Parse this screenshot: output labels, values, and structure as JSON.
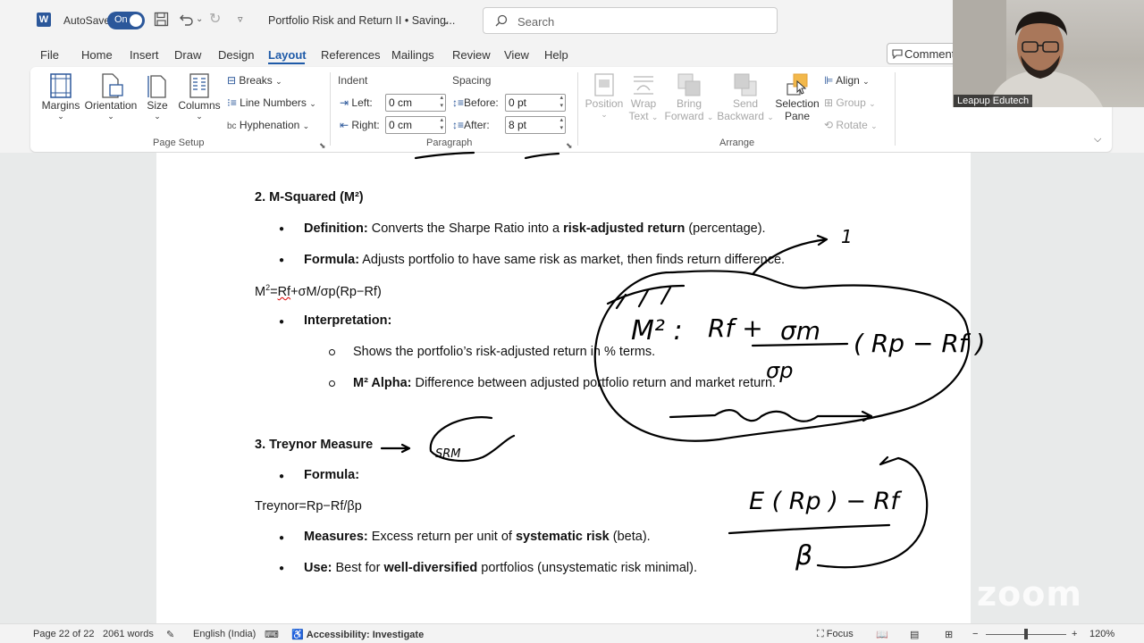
{
  "titlebar": {
    "app_icon": "word-icon",
    "app_icon_letter": "W",
    "autosave_label": "AutoSave",
    "autosave_state": "On",
    "document_title": "Portfolio Risk and Return II • Saving...",
    "search_placeholder": "Search"
  },
  "tabs": [
    "File",
    "Home",
    "Insert",
    "Draw",
    "Design",
    "Layout",
    "References",
    "Mailings",
    "Review",
    "View",
    "Help"
  ],
  "active_tab": "Layout",
  "comment_button": "Comment",
  "ribbon": {
    "page_setup": {
      "label": "Page Setup",
      "margins": "Margins",
      "orientation": "Orientation",
      "size": "Size",
      "columns": "Columns",
      "breaks": "Breaks",
      "line_numbers": "Line Numbers",
      "hyphenation": "Hyphenation"
    },
    "paragraph": {
      "label": "Paragraph",
      "indent_header": "Indent",
      "spacing_header": "Spacing",
      "left_label": "Left:",
      "left_value": "0 cm",
      "right_label": "Right:",
      "right_value": "0 cm",
      "before_label": "Before:",
      "before_value": "0 pt",
      "after_label": "After:",
      "after_value": "8 pt"
    },
    "arrange": {
      "label": "Arrange",
      "position": "Position",
      "wrap_text_1": "Wrap",
      "wrap_text_2": "Text",
      "bring_forward_1": "Bring",
      "bring_forward_2": "Forward",
      "send_backward_1": "Send",
      "send_backward_2": "Backward",
      "selection_pane_1": "Selection",
      "selection_pane_2": "Pane",
      "align": "Align",
      "group": "Group",
      "rotate": "Rotate"
    }
  },
  "document": {
    "h_msquared": "2. M-Squared (M²)",
    "def_label": "Definition:",
    "def_text_1": " Converts the Sharpe Ratio into a ",
    "def_bold": "risk-adjusted return",
    "def_text_2": " (percentage).",
    "formula_label": "Formula:",
    "formula_text": " Adjusts portfolio to have same risk as market, then finds return difference.",
    "m2_eq_prefix": "M",
    "m2_eq_sup": "2",
    "m2_eq_eq": "=",
    "m2_eq_rest": "Rf+σM/σp(Rp−Rf)",
    "m2_eq_rf": "Rf",
    "interp_label": "Interpretation:",
    "sub1": "Shows the portfolio’s risk-adjusted return in % terms.",
    "sub2_label": "M² Alpha:",
    "sub2_text": " Difference between adjusted portfolio return and market return.",
    "h_treynor": "3. Treynor Measure",
    "t_formula_label": "Formula:",
    "t_eq": "Treynor=Rp−Rf/βp",
    "measures_label": "Measures:",
    "measures_text_1": " Excess return per unit of ",
    "measures_bold": "systematic risk",
    "measures_text_2": " (beta).",
    "use_label": "Use:",
    "use_text_1": " Best for ",
    "use_bold": "well-diversified",
    "use_text_2": " portfolios (unsystematic risk minimal)."
  },
  "statusbar": {
    "page": "Page 22 of 22",
    "words": "2061 words",
    "language": "English (India)",
    "accessibility": "Accessibility: Investigate",
    "focus": "Focus",
    "zoom": "120%",
    "zoom_level_fraction": 0.5
  },
  "webcam": {
    "participant_name": "Leapup Edutech"
  },
  "zoom_watermark": "zoom",
  "annotations": {
    "num_one": "1",
    "m2_lhs": "M² :",
    "rf_plus": "Rf +",
    "sigma_m": "σm",
    "rp_rf": "( Rp − Rf )",
    "sigma_p": "σp",
    "erp": "E ( Rp ) − Rf",
    "beta": "β",
    "srm": "SRM"
  },
  "colors": {
    "accent": "#2b579a",
    "tab_active": "#1e5aa8",
    "ink": "#000000"
  }
}
